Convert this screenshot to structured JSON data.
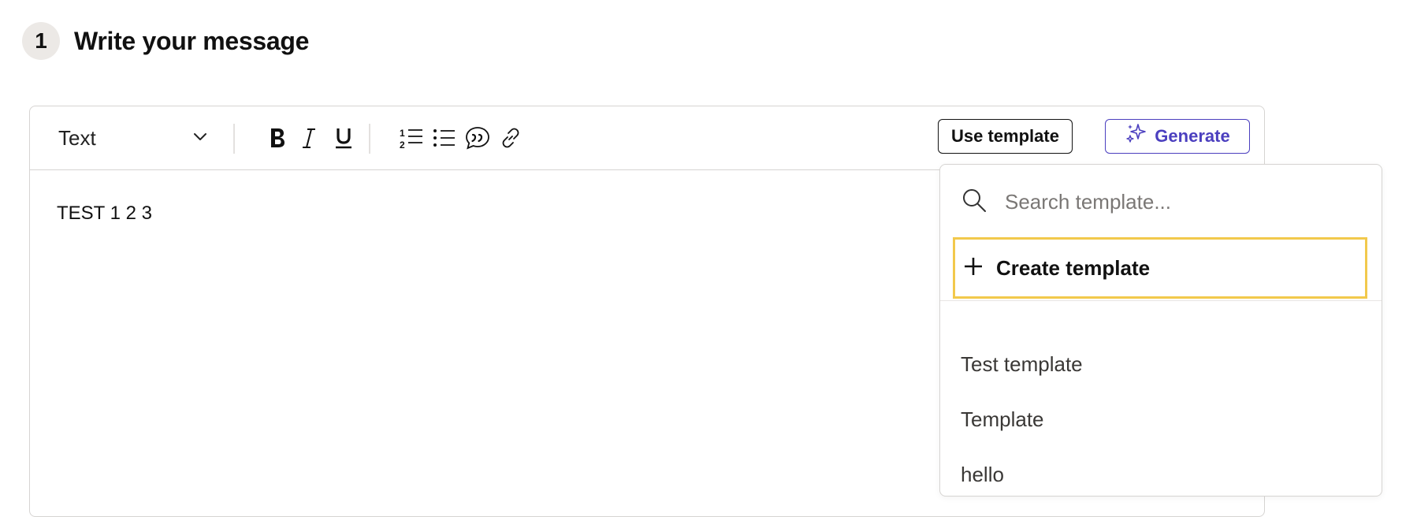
{
  "step": {
    "number": "1",
    "title": "Write your message"
  },
  "toolbar": {
    "text_style": "Text",
    "use_template_label": "Use template",
    "generate_label": "Generate"
  },
  "editor": {
    "content": "TEST 1 2 3"
  },
  "template_dropdown": {
    "search_placeholder": "Search template...",
    "create_label": "Create template",
    "items": [
      "Test template",
      "Template",
      "hello"
    ]
  },
  "colors": {
    "accent_purple": "#4b3fbf",
    "highlight_yellow": "#f2c94c",
    "border_gray": "#d6d4d2"
  }
}
